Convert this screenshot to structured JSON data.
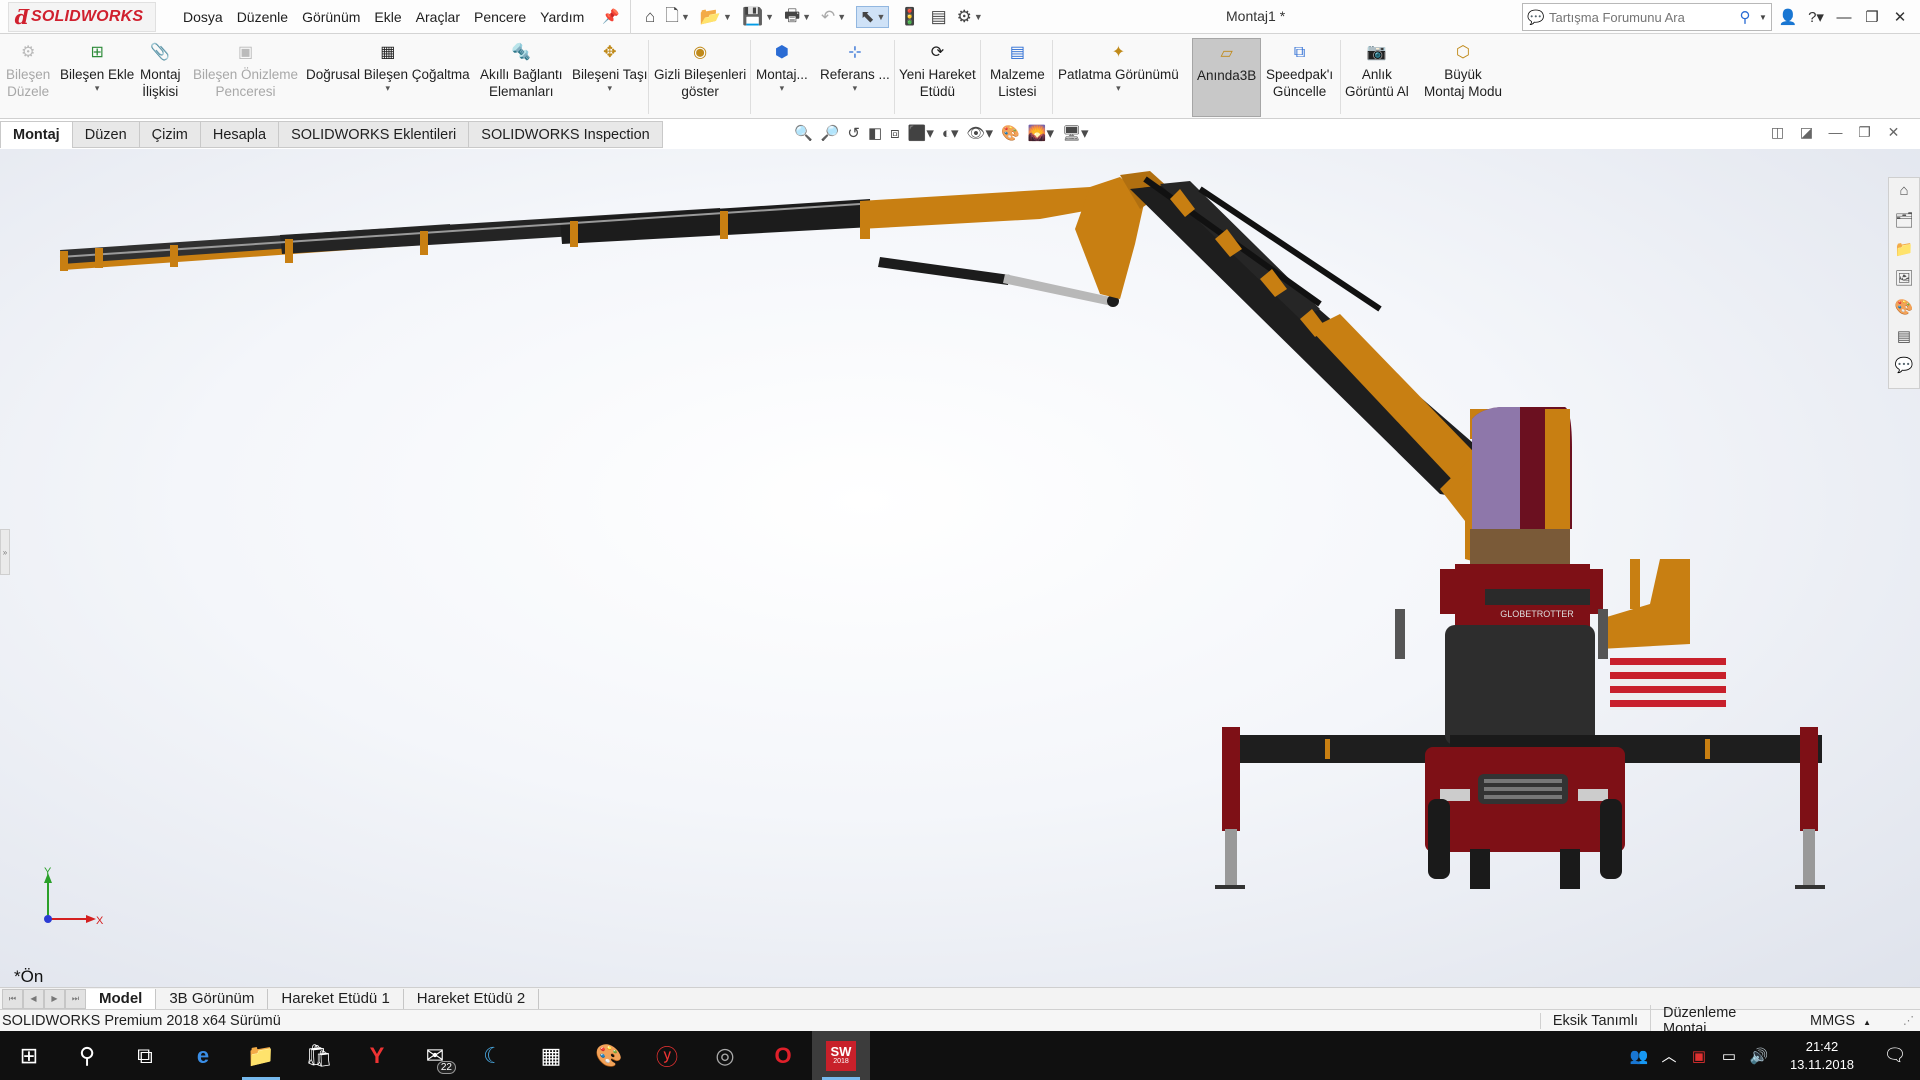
{
  "app": {
    "logo_text": "SOLIDWORKS",
    "document_title": "Montaj1 *"
  },
  "menus": [
    "Dosya",
    "Düzenle",
    "Görünüm",
    "Ekle",
    "Araçlar",
    "Pencere",
    "Yardım"
  ],
  "quick_access": {
    "icons": [
      "home-icon",
      "new-document-icon",
      "open-icon",
      "save-icon",
      "print-icon",
      "undo-icon",
      "select-icon",
      "rebuild-icon",
      "file-properties-icon",
      "options-icon"
    ]
  },
  "search": {
    "placeholder": "Tartışma Forumunu Ara"
  },
  "ribbon": {
    "buttons": [
      {
        "label1": "Bileşen",
        "label2": "Düzele",
        "disabled": true
      },
      {
        "label1": "Bileşen Ekle",
        "label2": "",
        "caret": true
      },
      {
        "label1": "Montaj",
        "label2": "İlişkisi"
      },
      {
        "label1": "Bileşen Önizleme",
        "label2": "Penceresi",
        "disabled": true
      },
      {
        "label1": "Doğrusal Bileşen Çoğaltma",
        "label2": "",
        "caret": true
      },
      {
        "label1": "Akıllı Bağlantı",
        "label2": "Elemanları"
      },
      {
        "label1": "Bileşeni Taşı",
        "label2": "",
        "caret": true
      },
      {
        "label1": "Gizli Bileşenleri",
        "label2": "göster"
      },
      {
        "label1": "Montaj...",
        "label2": "",
        "caret": true
      },
      {
        "label1": "Referans ...",
        "label2": "",
        "caret": true
      },
      {
        "label1": "Yeni Hareket",
        "label2": "Etüdü"
      },
      {
        "label1": "Malzeme",
        "label2": "Listesi"
      },
      {
        "label1": "Patlatma Görünümü",
        "label2": "",
        "caret": true
      },
      {
        "label1": "Anında3B",
        "label2": "",
        "active": true
      },
      {
        "label1": "Speedpak'ı",
        "label2": "Güncelle"
      },
      {
        "label1": "Anlık",
        "label2": "Görüntü Al"
      },
      {
        "label1": "Büyük",
        "label2": "Montaj Modu"
      }
    ]
  },
  "tabs": [
    "Montaj",
    "Düzen",
    "Çizim",
    "Hesapla",
    "SOLIDWORKS Eklentileri",
    "SOLIDWORKS Inspection"
  ],
  "graphics": {
    "view_label": "*Ön",
    "axis_x": "X",
    "axis_y": "Y",
    "truck_badge": "GLOBETROTTER",
    "colors": {
      "boom_orange": "#c87f12",
      "boom_black": "#1e1e1e",
      "truck_red": "#7e1016",
      "glass": "#9a9ad8"
    }
  },
  "model_tabs": [
    "Model",
    "3B Görünüm",
    "Hareket Etüdü 1",
    "Hareket Etüdü 2"
  ],
  "status": {
    "version": "SOLIDWORKS Premium 2018 x64 Sürümü",
    "defined": "Eksik Tanımlı",
    "mode": "Düzenleme Montaj",
    "units": "MMGS"
  },
  "taskbar": {
    "mail_badge": "22",
    "sw_label": "SW",
    "sw_year": "2018",
    "time": "21:42",
    "date": "13.11.2018"
  }
}
